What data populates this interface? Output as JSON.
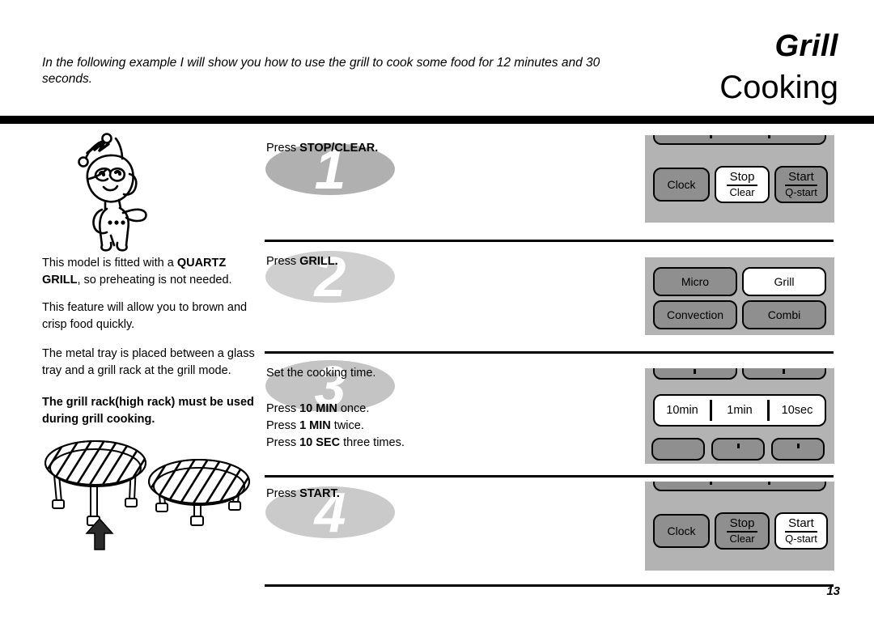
{
  "header": {
    "title_line1": "Grill",
    "title_line2": "Cooking",
    "intro": "In the following example I will show you how to use the grill to cook some food for 12 minutes and 30 seconds."
  },
  "left_column": {
    "mascot_alt": "cartoon mascot character waving",
    "paragraphs": [
      {
        "id": "p1",
        "html": "This model is fitted with a <b>QUARTZ GRILL</b>, so preheating is not needed."
      },
      {
        "id": "p2",
        "html": "This feature will allow you to brown and crisp food quickly."
      },
      {
        "id": "p3",
        "html": "The metal tray is placed between a glass tray and a grill rack at the grill mode."
      },
      {
        "id": "p4",
        "html": "The grill rack(high rack) must be used during grill cooking."
      }
    ],
    "rack_figure_alt": "two grill racks, high rack on the left indicated by an arrow"
  },
  "steps": [
    {
      "numeral": "1",
      "text_html": "Press <b>STOP/CLEAR.</b>",
      "panel": {
        "kind": "clock_stop_start",
        "partial_top": true,
        "buttons": [
          {
            "name": "clock",
            "label": "Clock",
            "active": false
          },
          {
            "name": "stop-clear",
            "top": "Stop",
            "bottom": "Clear",
            "active": true
          },
          {
            "name": "start-qstart",
            "top": "Start",
            "bottom": "Q-start",
            "active": false
          }
        ]
      }
    },
    {
      "numeral": "2",
      "text_html": "Press <b>GRILL.</b>",
      "panel": {
        "kind": "modes",
        "buttons": [
          {
            "name": "micro",
            "label": "Micro",
            "active": false
          },
          {
            "name": "grill",
            "label": "Grill",
            "active": true
          },
          {
            "name": "convection",
            "label": "Convection",
            "active": false
          },
          {
            "name": "combi",
            "label": "Combi",
            "active": false
          }
        ]
      }
    },
    {
      "numeral": "3",
      "text_html": "Set the cooking time.",
      "text_html_2": "Press <b>10 MIN</b> once.<br>Press <b>1 MIN</b> twice.<br>Press <b>10 SEC</b> three times.",
      "panel": {
        "kind": "time_strip",
        "segments": [
          "10min",
          "1min",
          "10sec"
        ]
      }
    },
    {
      "numeral": "4",
      "text_html": "Press <b>START.</b>",
      "panel": {
        "kind": "clock_stop_start",
        "partial_top": true,
        "buttons": [
          {
            "name": "clock",
            "label": "Clock",
            "active": false
          },
          {
            "name": "stop-clear",
            "top": "Stop",
            "bottom": "Clear",
            "active": false
          },
          {
            "name": "start-qstart",
            "top": "Start",
            "bottom": "Q-start",
            "active": true
          }
        ]
      }
    }
  ],
  "footer": {
    "page_number": "13"
  },
  "colors": {
    "panel_bg": "#b3b3b3",
    "button_inactive": "#8f8f8f",
    "button_active": "#ffffff",
    "rule": "#000000"
  }
}
